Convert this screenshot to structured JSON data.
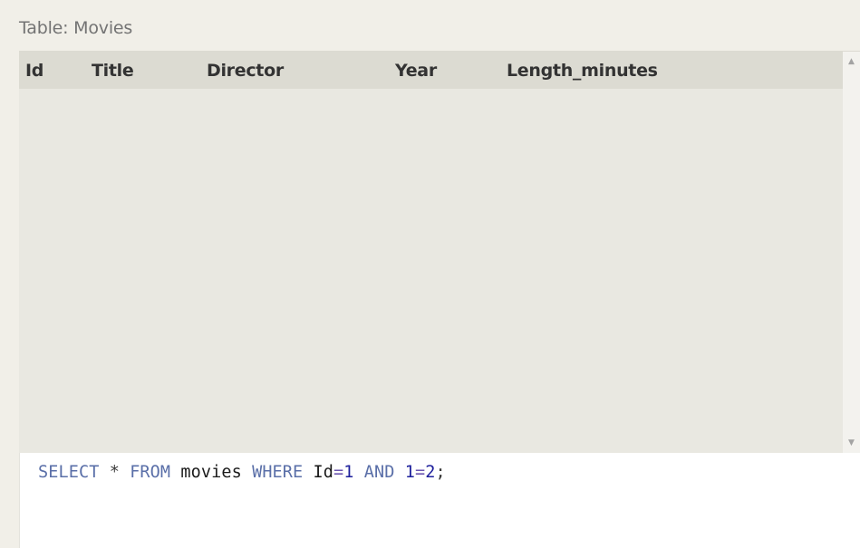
{
  "table_label": "Table: Movies",
  "results": {
    "columns": [
      {
        "label": "Id"
      },
      {
        "label": "Title"
      },
      {
        "label": "Director"
      },
      {
        "label": "Year"
      },
      {
        "label": "Length_minutes"
      }
    ],
    "rows": []
  },
  "scrollbar": {
    "up_glyph": "▲",
    "down_glyph": "▼"
  },
  "editor": {
    "tokens": [
      {
        "text": "SELECT",
        "kind": "kw"
      },
      {
        "text": " ",
        "kind": "sp"
      },
      {
        "text": "*",
        "kind": "op"
      },
      {
        "text": " ",
        "kind": "sp"
      },
      {
        "text": "FROM",
        "kind": "kw"
      },
      {
        "text": " ",
        "kind": "sp"
      },
      {
        "text": "movies",
        "kind": "ident"
      },
      {
        "text": " ",
        "kind": "sp"
      },
      {
        "text": "WHERE",
        "kind": "kw"
      },
      {
        "text": " ",
        "kind": "sp"
      },
      {
        "text": "Id",
        "kind": "ident"
      },
      {
        "text": "=",
        "kind": "opeq"
      },
      {
        "text": "1",
        "kind": "num"
      },
      {
        "text": " ",
        "kind": "sp"
      },
      {
        "text": "AND",
        "kind": "kw"
      },
      {
        "text": " ",
        "kind": "sp"
      },
      {
        "text": "1",
        "kind": "num"
      },
      {
        "text": "=",
        "kind": "opeq"
      },
      {
        "text": "2",
        "kind": "num"
      },
      {
        "text": ";",
        "kind": "op"
      }
    ]
  }
}
